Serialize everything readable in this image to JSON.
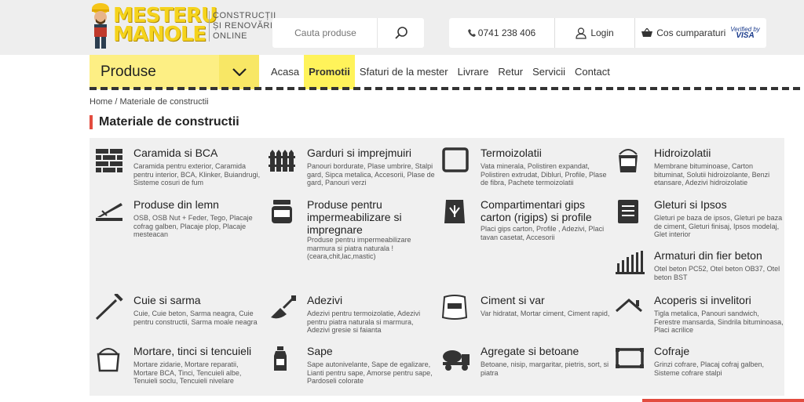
{
  "header": {
    "logo_line1": "MESTERU",
    "logo_line2": "MANOLE",
    "logo_sub1": "CONSTRUCȚII",
    "logo_sub2": "ȘI RENOVĂRI",
    "logo_sub3": "ONLINE",
    "search_placeholder": "Cauta produse",
    "phone": "0741 238 406",
    "login": "Login",
    "cart": "Cos cumparaturi",
    "verified_by": "Verified by",
    "visa": "VISA"
  },
  "nav": {
    "produse": "Produse",
    "items": [
      "Acasa",
      "Promotii",
      "Sfaturi de la mester",
      "Livrare",
      "Retur",
      "Servicii",
      "Contact"
    ]
  },
  "breadcrumb": "Home / Materiale de constructii",
  "page_title": "Materiale de constructii",
  "categories": [
    {
      "name": "Caramida si BCA",
      "desc": "Caramida pentru exterior, Caramida pentru interior, BCA, Klinker, Buiandrugi, Sisteme cosuri de fum",
      "icon": "brick-wall-icon"
    },
    {
      "name": "Garduri si imprejmuiri",
      "desc": "Panouri bordurate, Plase umbrire, Stalpi gard, Sipca metalica, Accesorii, Plase de gard, Panouri verzi",
      "icon": "fence-icon"
    },
    {
      "name": "Termoizolatii",
      "desc": "Vata minerala, Polistiren expandat, Polistiren extrudat, Dibluri, Profile, Plase de fibra, Pachete termoizolatii",
      "icon": "square-frame-icon"
    },
    {
      "name": "Hidroizolatii",
      "desc": "Membrane bituminoase, Carton bituminat, Solutii hidroizolante, Benzi etansare, Adezivi hidroizolatie",
      "icon": "bucket-icon"
    },
    {
      "name": "Produse din lemn",
      "desc": "OSB, OSB Nut + Feder, Tego, Placaje cofrag galben, Placaje plop, Placaje mesteacan",
      "icon": "wood-plank-icon"
    },
    {
      "name": "Produse pentru impermeabilizare si impregnare",
      "desc": "Produse pentru impermeabilizare marmura si piatra naturala ! (ceara,chit,lac,mastic)",
      "icon": "jar-icon"
    },
    {
      "name": "Compartimentari gips carton (rigips) si profile",
      "desc": "Placi gips carton, Profile , Adezivi, Placi tavan casetat, Accesorii",
      "icon": "sack-icon"
    },
    {
      "name": "Gleturi si Ipsos",
      "desc": "Gleturi pe baza de ipsos, Gleturi pe baza de ciment, Gleturi finisaj, Ipsos modelaj, Glet interior",
      "icon": "glet-bag-icon"
    },
    {
      "name": "Armaturi din fier beton",
      "desc": "Otel beton PC52, Otel beton OB37, Otel beton BST",
      "icon": "rebar-icon"
    },
    {
      "name": "Cuie si sarma",
      "desc": "Cuie, Cuie beton, Sarma neagra, Cuie pentru constructii, Sarma moale neagra",
      "icon": "nail-icon"
    },
    {
      "name": "Adezivi",
      "desc": "Adezivi pentru termoizolatie, Adezivi pentru piatra naturala si marmura, Adezivi gresie si faianta",
      "icon": "trowel-icon"
    },
    {
      "name": "Ciment si var",
      "desc": "Var hidratat, Mortar ciment, Ciment rapid,",
      "icon": "cement-bag-icon"
    },
    {
      "name": "Acoperis si invelitori",
      "desc": "Tigla metalica, Panouri sandwich, Ferestre mansarda, Sindrila bituminoasa, Placi acrilice",
      "icon": "roof-icon"
    },
    {
      "name": "Mortare, tinci si tencuieli",
      "desc": "Mortare zidarie, Mortare reparatii, Mortare BCA, Tinci, Tencuieli albe, Tenuieli soclu, Tencuieli nivelare",
      "icon": "paint-bucket-icon"
    },
    {
      "name": "Sape",
      "desc": "Sape autonivelante, Sape de egalizare, Lianti pentru sape, Amorse pentru sape, Pardoseli colorate",
      "icon": "bottle-icon"
    },
    {
      "name": "Agregate si betoane",
      "desc": "Betoane, nisip, margaritar, pietris, sort, si piatra",
      "icon": "mixer-truck-icon"
    },
    {
      "name": "Cofraje",
      "desc": "Grinzi cofrare, Placaj cofraj galben, Sisteme cofrare stalpi",
      "icon": "formwork-icon"
    }
  ]
}
